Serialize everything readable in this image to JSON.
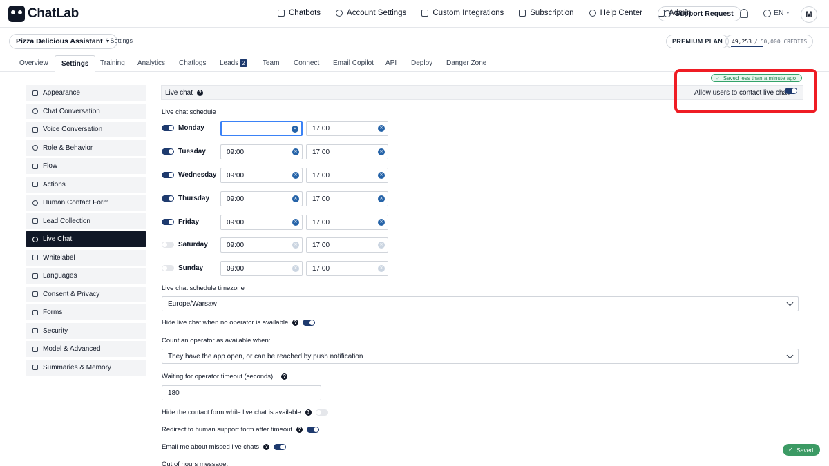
{
  "app": {
    "name": "ChatLab"
  },
  "nav": {
    "links": [
      {
        "label": "Chatbots",
        "icon": "chatbot-icon"
      },
      {
        "label": "Account Settings",
        "icon": "gear-icon"
      },
      {
        "label": "Custom Integrations",
        "icon": "puzzle-icon"
      },
      {
        "label": "Subscription",
        "icon": "card-icon"
      },
      {
        "label": "Help Center",
        "icon": "help-icon"
      },
      {
        "label": "Admin",
        "icon": "shield-icon"
      }
    ],
    "support_label": "Support Request",
    "language": "EN",
    "avatar_initial": "M"
  },
  "header": {
    "bot_name": "Pizza Delicious Assistant",
    "breadcrumb": "Settings",
    "plan": "PREMIUM PLAN",
    "credits_used": "49,253",
    "credits_separator": "/",
    "credits_total": "50,000 CREDITS",
    "credits_progress": 0.985
  },
  "tabs": [
    "Overview",
    "Settings",
    "Training",
    "Analytics",
    "Chatlogs",
    "Leads",
    "Team",
    "Connect",
    "Email Copilot",
    "API",
    "Deploy",
    "Danger Zone"
  ],
  "tabs_active": "Settings",
  "leads_count": "2",
  "sidebar": {
    "active": "Live Chat",
    "items": [
      "Appearance",
      "Chat Conversation",
      "Voice Conversation",
      "Role & Behavior",
      "Flow",
      "Actions",
      "Human Contact Form",
      "Lead Collection",
      "Live Chat",
      "Whitelabel",
      "Languages",
      "Consent & Privacy",
      "Forms",
      "Security",
      "Model & Advanced",
      "Summaries & Memory"
    ]
  },
  "livechat": {
    "section_title": "Live chat",
    "saved_status": "Saved less than a minute ago",
    "allow_label": "Allow users to contact live chat:",
    "allow_enabled": true,
    "schedule_label": "Live chat schedule",
    "schedule": [
      {
        "day": "Monday",
        "enabled": true,
        "start": "",
        "end": "17:00"
      },
      {
        "day": "Tuesday",
        "enabled": true,
        "start": "09:00",
        "end": "17:00"
      },
      {
        "day": "Wednesday",
        "enabled": true,
        "start": "09:00",
        "end": "17:00"
      },
      {
        "day": "Thursday",
        "enabled": true,
        "start": "09:00",
        "end": "17:00"
      },
      {
        "day": "Friday",
        "enabled": true,
        "start": "09:00",
        "end": "17:00"
      },
      {
        "day": "Saturday",
        "enabled": false,
        "start": "09:00",
        "end": "17:00"
      },
      {
        "day": "Sunday",
        "enabled": false,
        "start": "09:00",
        "end": "17:00"
      }
    ],
    "timezone_label": "Live chat schedule timezone",
    "timezone_value": "Europe/Warsaw",
    "hide_no_operator_label": "Hide live chat when no operator is available",
    "hide_no_operator_enabled": true,
    "count_operator_label": "Count an operator as available when:",
    "count_operator_value": "They have the app open, or can be reached by push notification",
    "timeout_label": "Waiting for operator timeout (seconds)",
    "timeout_value": "180",
    "hide_contact_form_label": "Hide the contact form while live chat is available",
    "hide_contact_form_enabled": false,
    "redirect_label": "Redirect to human support form after timeout",
    "redirect_enabled": true,
    "email_missed_label": "Email me about missed live chats",
    "email_missed_enabled": true,
    "out_of_hours_label": "Out of hours message:"
  },
  "toast": {
    "label": "Saved"
  },
  "colors": {
    "accent": "#1e3a6e",
    "highlight": "#ef1c24",
    "success": "#3c9a64"
  }
}
